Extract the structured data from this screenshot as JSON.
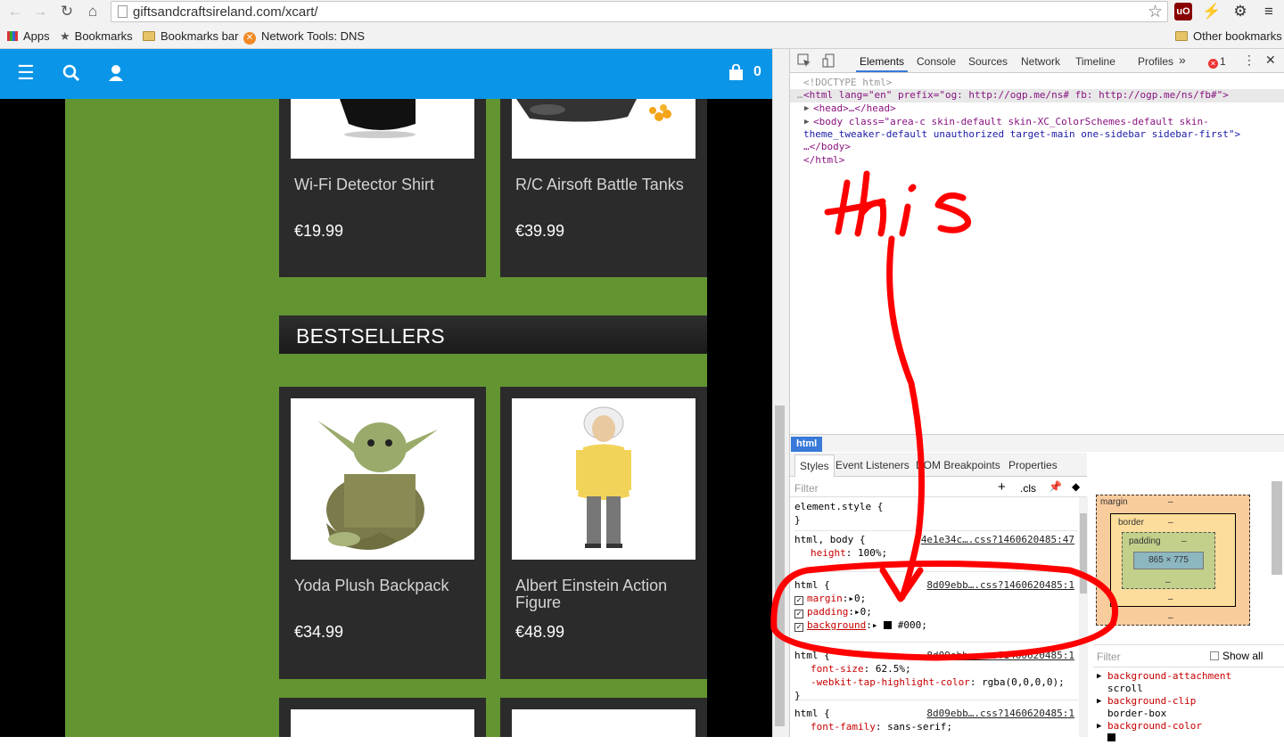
{
  "browser": {
    "url": "giftsandcraftsireland.com/xcart/",
    "bookmarks": [
      "Apps",
      "Bookmarks",
      "Bookmarks bar",
      "Network Tools: DNS,IP"
    ],
    "other_bookmarks": "Other bookmarks"
  },
  "site": {
    "cart_count": "0",
    "products_top": [
      {
        "name": "Wi-Fi Detector Shirt",
        "price": "€19.99"
      },
      {
        "name": "R/C Airsoft Battle Tanks",
        "price": "€39.99"
      }
    ],
    "section_title": "BESTSELLERS",
    "products_best": [
      {
        "name": "Yoda Plush Backpack",
        "price": "€34.99"
      },
      {
        "name": "Albert Einstein Action Figure",
        "price": "€48.99"
      }
    ]
  },
  "devtools": {
    "tabs": [
      "Elements",
      "Console",
      "Sources",
      "Network",
      "Timeline",
      "Profiles"
    ],
    "error_count": "1",
    "dom": {
      "doctype": "<!DOCTYPE html>",
      "html_open": "<html lang=\"en\" prefix=\"og: http://ogp.me/ns# fb: http://ogp.me/ns/fb#\">",
      "head": "<head>…</head>",
      "body_line1": "<body class=\"area-c skin-default skin-XC_ColorSchemes-default skin-",
      "body_line2": "theme_tweaker-default unauthorized target-main one-sidebar sidebar-first\">",
      "body_close": "…</body>",
      "html_close": "</html>"
    },
    "breadcrumb": "html",
    "style_tabs": [
      "Styles",
      "Event Listeners",
      "DOM Breakpoints",
      "Properties"
    ],
    "filter_placeholder": "Filter",
    "cls": ".cls",
    "rules": {
      "element_style": "element.style {",
      "r1_selector": "html, body {",
      "r1_source": "4e1e34c….css?1460620485:47",
      "r1_prop": "height",
      "r1_val": "100%;",
      "r2_selector": "html {",
      "r2_source": "8d09ebb….css?1460620485:1",
      "r2_margin": "margin",
      "r2_margin_val": "0;",
      "r2_padding": "padding",
      "r2_padding_val": "0;",
      "r2_bg": "background",
      "r2_bg_val": "#000;",
      "r3_selector": "html {",
      "r3_source": "8d09ebb….css?1460620485:1",
      "r3_fs": "font-size",
      "r3_fs_val": "62.5%;",
      "r3_tap": "-webkit-tap-highlight-color",
      "r3_tap_val": "rgba(0,0,0,0);",
      "r4_selector": "html {",
      "r4_source": "8d09ebb….css?1460620485:1",
      "r4_ff": "font-family",
      "r4_ff_val": "sans-serif;"
    },
    "box_model": {
      "margin": "margin",
      "border": "border",
      "padding": "padding",
      "content": "865 × 775",
      "dash": "–"
    },
    "computed_filter": "Filter",
    "show_all": "Show all",
    "computed": [
      {
        "prop": "background-attachment",
        "val": "scroll"
      },
      {
        "prop": "background-clip",
        "val": "border-box"
      },
      {
        "prop": "background-color",
        "val": ""
      }
    ]
  },
  "annotation": {
    "text": "this",
    "color": "#ff0000"
  }
}
